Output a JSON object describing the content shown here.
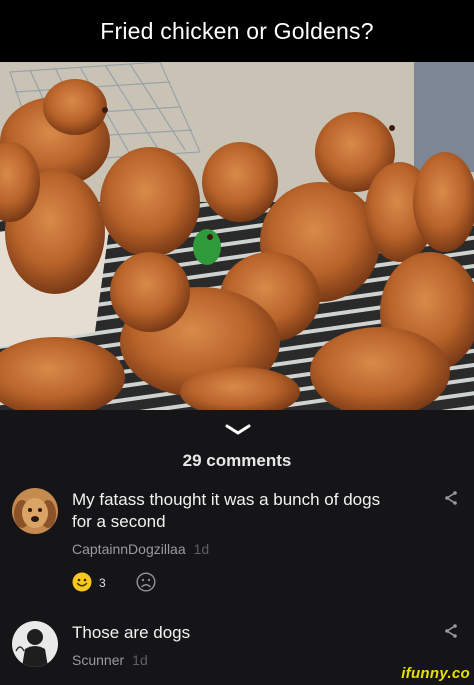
{
  "post": {
    "title": "Fried chicken or Goldens?"
  },
  "comments_section": {
    "count_label": "29 comments",
    "comments": [
      {
        "text_line1": "My fatass thought it was a bunch of dogs",
        "text_line2": "for a second",
        "author": "CaptainnDogzillaa",
        "time": "1d",
        "smile_count": "3"
      },
      {
        "text_line1": "Those are dogs",
        "author": "Scunner",
        "time": "1d"
      }
    ]
  },
  "watermark": "ifunny.co",
  "icons": [
    "chevron-down-icon",
    "share-icon",
    "smile-reaction-icon",
    "sad-reaction-icon",
    "avatar-dog",
    "avatar-person"
  ],
  "colors": {
    "background": "#000000",
    "panel": "#151517",
    "reaction_yellow": "#f7c91c",
    "watermark": "#e7e000",
    "muted_text": "#9a9a9f"
  }
}
